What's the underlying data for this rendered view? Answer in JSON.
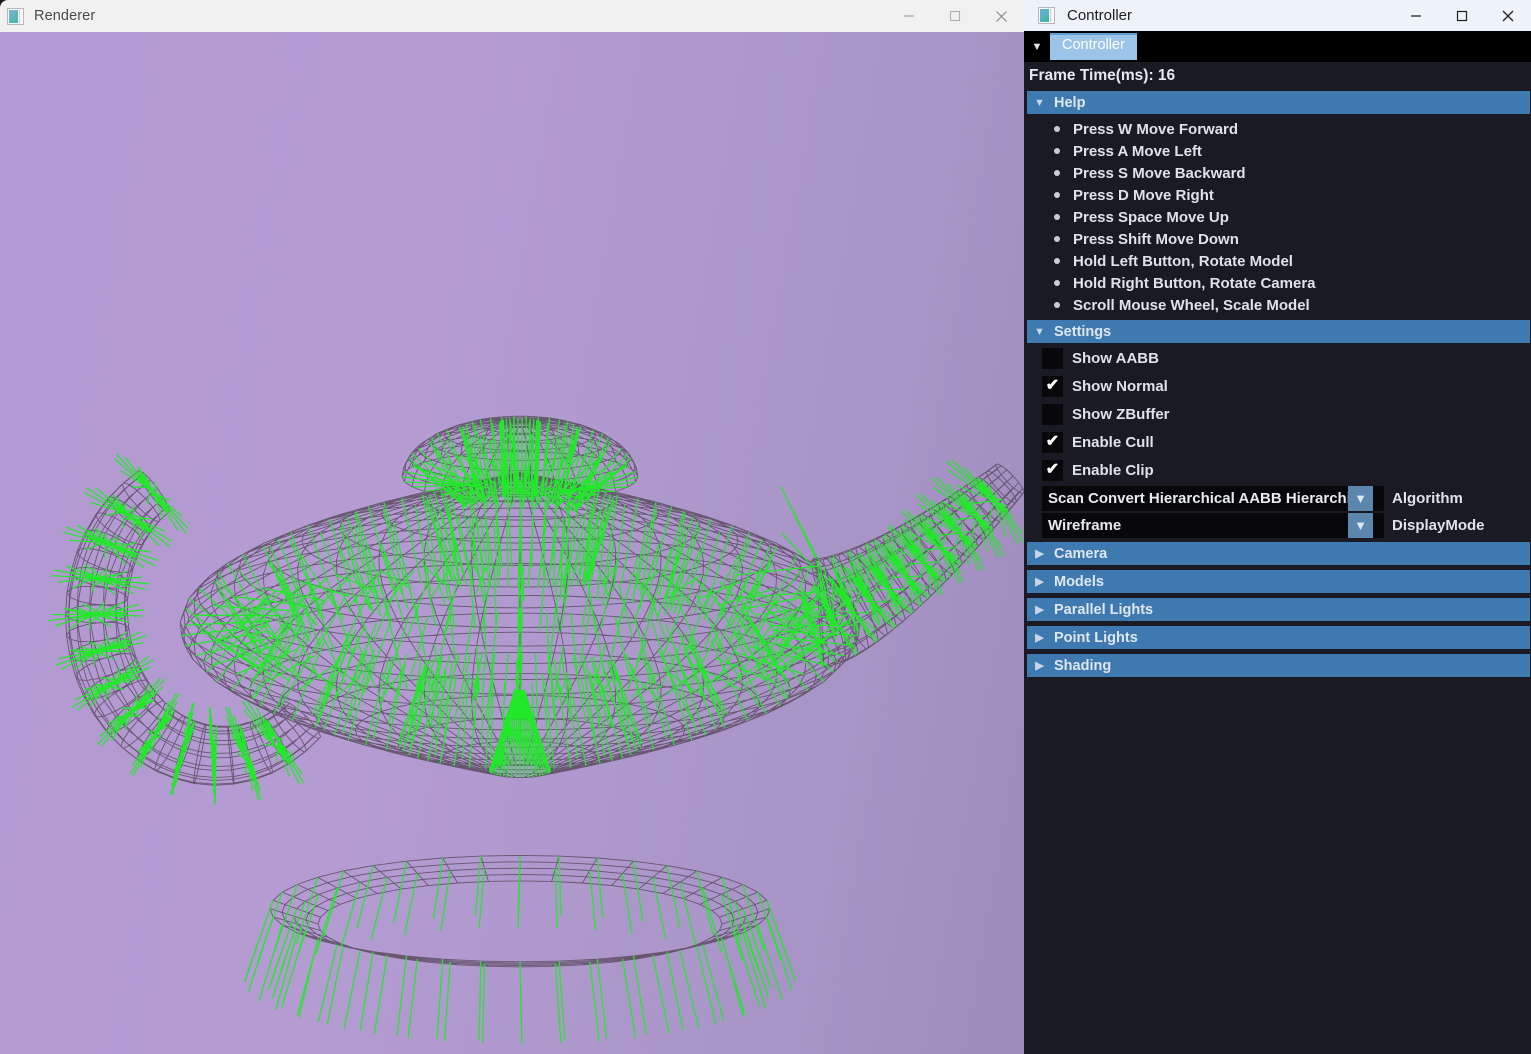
{
  "renderer_window": {
    "title": "Renderer",
    "icon": "app-icon",
    "controls": {
      "minimize": "—",
      "maximize": "□",
      "close": "✕"
    },
    "canvas": {
      "background_color": "#b29ad2",
      "wireframe_color": "#4a3c4f",
      "normal_color": "#22e82a",
      "model": "teapot"
    }
  },
  "controller_window": {
    "title": "Controller",
    "icon": "app-icon",
    "controls": {
      "minimize": "—",
      "maximize": "□",
      "close": "✕"
    },
    "tabstrip": {
      "collapse_icon": "▼",
      "active_tab": "Controller"
    },
    "frame_time": "Frame Time(ms): 16",
    "sections": {
      "help": {
        "label": "Help",
        "expanded": true,
        "arrow": "▼",
        "items": [
          "Press W Move Forward",
          "Press A Move Left",
          "Press S Move Backward",
          "Press D Move Right",
          "Press Space Move Up",
          "Press Shift Move Down",
          "Hold Left Button, Rotate Model",
          "Hold Right Button, Rotate Camera",
          "Scroll Mouse Wheel, Scale Model"
        ]
      },
      "settings": {
        "label": "Settings",
        "expanded": true,
        "arrow": "▼",
        "checkboxes": [
          {
            "label": "Show AABB",
            "checked": false
          },
          {
            "label": "Show Normal",
            "checked": true
          },
          {
            "label": "Show ZBuffer",
            "checked": false
          },
          {
            "label": "Enable Cull",
            "checked": true
          },
          {
            "label": "Enable Clip",
            "checked": true
          }
        ],
        "combos": [
          {
            "value": "Scan Convert Hierarchical AABB Hierarchica",
            "label": "Algorithm",
            "arrow": "▼"
          },
          {
            "value": "Wireframe",
            "label": "DisplayMode",
            "arrow": "▼"
          }
        ]
      },
      "collapsed": [
        {
          "label": "Camera",
          "arrow": "▶"
        },
        {
          "label": "Models",
          "arrow": "▶"
        },
        {
          "label": "Parallel Lights",
          "arrow": "▶"
        },
        {
          "label": "Point Lights",
          "arrow": "▶"
        },
        {
          "label": "Shading",
          "arrow": "▶"
        }
      ]
    },
    "colors": {
      "header_blue": "#3e7ab0",
      "panel_bg": "#191a24",
      "tab_active": "#9cc4e8",
      "text": "#dfe2e8"
    }
  }
}
